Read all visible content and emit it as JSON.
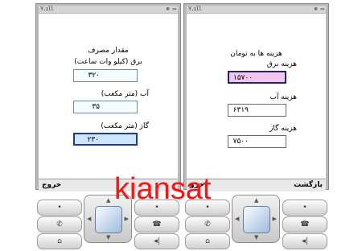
{
  "left_phone": {
    "status": {
      "signal": "Y.ıll",
      "icons": "⊛ ▭"
    },
    "title": "مقدار مصرف",
    "fields": [
      {
        "label": "برق (کیلو وات ساعت)",
        "value": "۳۲۰"
      },
      {
        "label": "آب (متر مکعب)",
        "value": "۳۵"
      },
      {
        "label": "گاز (متر مکعب)",
        "value": "۲۳۰"
      }
    ],
    "softkey_left": "خروج",
    "softkey_right": ""
  },
  "right_phone": {
    "status": {
      "signal": "Y.ıll",
      "icons": "⊛ ▭"
    },
    "title": "هزینه ها به تومان",
    "fields": [
      {
        "label": "هزینه برق",
        "value": "۱۵۷۰۰"
      },
      {
        "label": "هزینه آب",
        "value": "۶۳۱۹"
      },
      {
        "label": "هزینه گاز",
        "value": "۷۵۰۰"
      }
    ],
    "softkey_left": "خرو",
    "softkey_right": "بازگشت"
  },
  "keypad": {
    "call_icon": "phone-call-icon",
    "end_icon": "phone-hangup-icon",
    "home_icon": "home-icon",
    "back_icon": "back-icon",
    "dot": "•"
  },
  "watermark": "kiansat"
}
